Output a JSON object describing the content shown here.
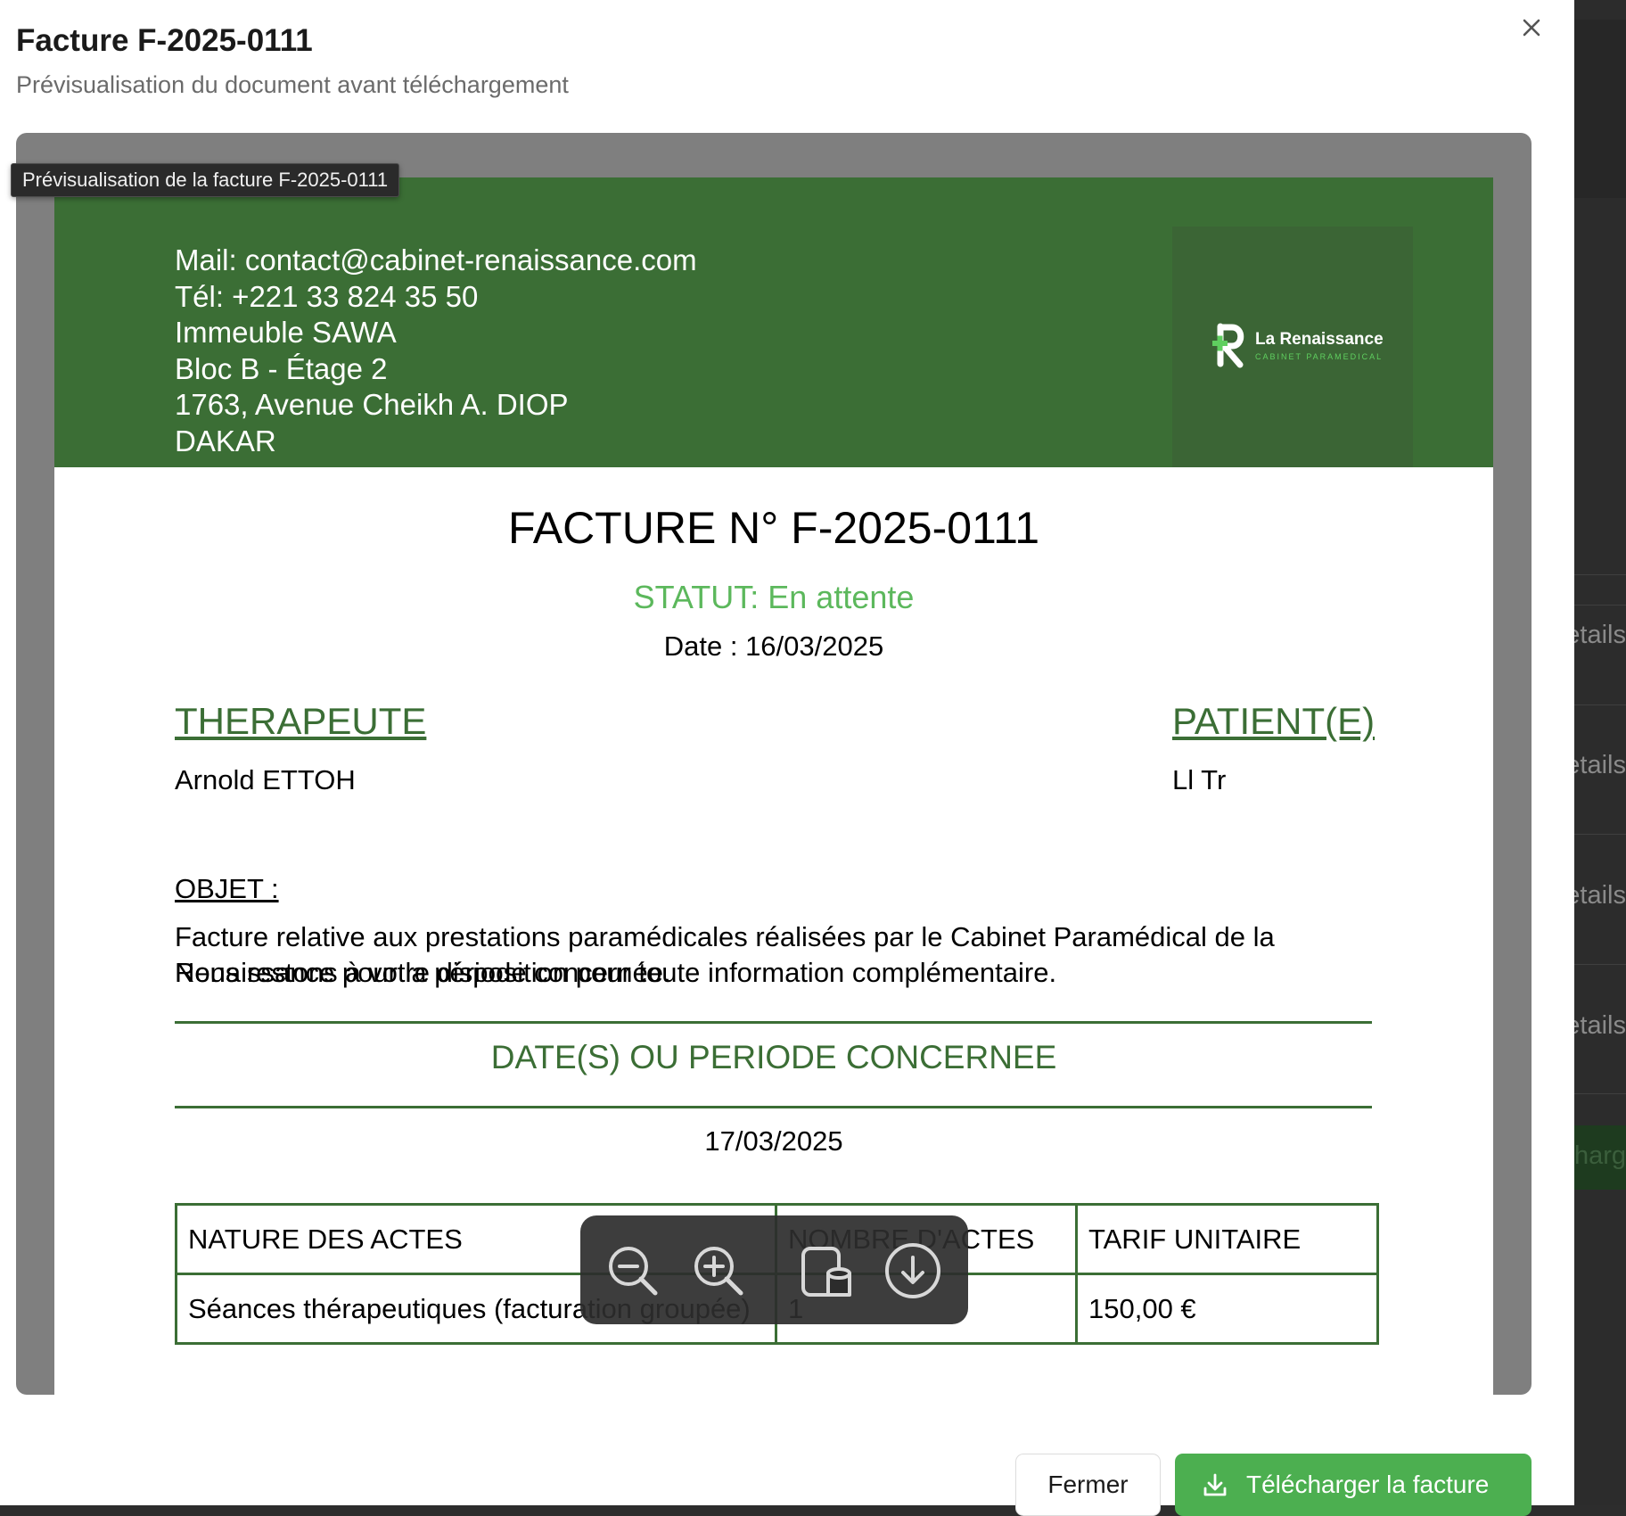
{
  "modal": {
    "title": "Facture F-2025-0111",
    "subtitle": "Prévisualisation du document avant téléchargement",
    "close_icon": "close-icon"
  },
  "viewer": {
    "tooltip": "Prévisualisation de la facture F-2025-0111",
    "toolbar_icons": [
      "zoom-out-icon",
      "zoom-in-icon",
      "rotate-icon",
      "download-icon"
    ]
  },
  "invoice": {
    "contact_lines": [
      "Mail: contact@cabinet-renaissance.com",
      "Tél: +221 33 824 35 50",
      "Immeuble SAWA",
      "Bloc B - Étage 2",
      "1763, Avenue Cheikh A. DIOP",
      "DAKAR"
    ],
    "logo": {
      "name": "La Renaissance",
      "tagline": "CABINET PARAMEDICAL"
    },
    "title": "FACTURE N° F-2025-0111",
    "status": "STATUT: En attente",
    "date": "Date : 16/03/2025",
    "therapist": {
      "label": "THERAPEUTE",
      "name": "Arnold ETTOH"
    },
    "patient": {
      "label": "PATIENT(E)",
      "name": "Ll Tr"
    },
    "objet": {
      "label": "OBJET :",
      "text": "Facture relative aux prestations paramédicales réalisées par le Cabinet Paramédical de la Renaissance pour la période concernée.",
      "text2": "Nous restons à votre disposition pour toute information complémentaire."
    },
    "period": {
      "title": "DATE(S) OU PERIODE CONCERNEE",
      "date": "17/03/2025"
    },
    "table": {
      "headers": [
        "NATURE DES ACTES",
        "NOMBRE D'ACTES",
        "TARIF UNITAIRE"
      ],
      "rows": [
        [
          "Séances thérapeutiques (facturation groupée)",
          "1",
          "150,00 €"
        ]
      ]
    }
  },
  "footer": {
    "close_label": "Fermer",
    "download_label": "Télécharger la facture"
  },
  "background": {
    "row_texts": [
      "etails",
      "etails",
      "etails",
      "etails"
    ],
    "button_text": "harg"
  },
  "colors": {
    "brand_green": "#3b6e35",
    "status_green": "#5cb85c",
    "button_green": "#4caf50"
  }
}
